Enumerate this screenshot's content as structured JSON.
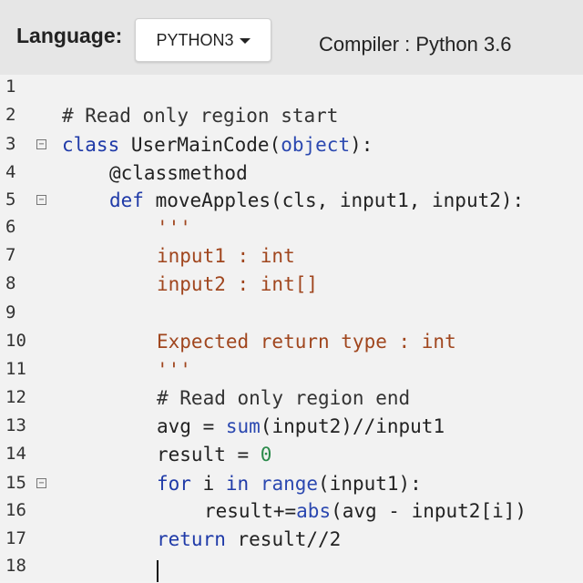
{
  "toolbar": {
    "language_label": "Language:",
    "language_value": "PYTHON3",
    "compiler_text": "Compiler : Python 3.6"
  },
  "editor": {
    "lines": [
      {
        "num": "1",
        "segments": []
      },
      {
        "num": "2",
        "segments": [
          {
            "text": "# Read only region start",
            "type": "comment"
          }
        ]
      },
      {
        "num": "3",
        "fold": true,
        "segments": [
          {
            "text": "class ",
            "type": "kw"
          },
          {
            "text": "UserMainCode(",
            "type": "plain"
          },
          {
            "text": "object",
            "type": "builtin"
          },
          {
            "text": "):",
            "type": "plain"
          }
        ]
      },
      {
        "num": "4",
        "segments": [
          {
            "text": "@classmethod",
            "type": "plain"
          }
        ]
      },
      {
        "num": "5",
        "fold": true,
        "segments": [
          {
            "text": "def ",
            "type": "kw"
          },
          {
            "text": "moveApples(cls, input1, input2):",
            "type": "plain"
          }
        ]
      },
      {
        "num": "6",
        "segments": [
          {
            "text": "'''",
            "type": "doc"
          }
        ]
      },
      {
        "num": "7",
        "segments": [
          {
            "text": "input1 : int",
            "type": "doc"
          }
        ]
      },
      {
        "num": "8",
        "segments": [
          {
            "text": "input2 : int[]",
            "type": "doc"
          }
        ]
      },
      {
        "num": "9",
        "segments": []
      },
      {
        "num": "10",
        "segments": [
          {
            "text": "Expected return type : int",
            "type": "doc"
          }
        ]
      },
      {
        "num": "11",
        "segments": [
          {
            "text": "'''",
            "type": "doc"
          }
        ]
      },
      {
        "num": "12",
        "segments": [
          {
            "text": "# Read only region end",
            "type": "comment"
          }
        ]
      },
      {
        "num": "13",
        "segments": [
          {
            "text": "avg = ",
            "type": "plain"
          },
          {
            "text": "sum",
            "type": "builtin"
          },
          {
            "text": "(input2)//input1",
            "type": "plain"
          }
        ]
      },
      {
        "num": "14",
        "segments": [
          {
            "text": "result = ",
            "type": "plain"
          },
          {
            "text": "0",
            "type": "num"
          }
        ]
      },
      {
        "num": "15",
        "fold": true,
        "segments": [
          {
            "text": "for ",
            "type": "kw"
          },
          {
            "text": "i ",
            "type": "plain"
          },
          {
            "text": "in ",
            "type": "kw"
          },
          {
            "text": "range",
            "type": "builtin"
          },
          {
            "text": "(input1):",
            "type": "plain"
          }
        ]
      },
      {
        "num": "16",
        "segments": [
          {
            "text": "result+=",
            "type": "plain"
          },
          {
            "text": "abs",
            "type": "builtin"
          },
          {
            "text": "(avg - input2[i])",
            "type": "plain"
          }
        ]
      },
      {
        "num": "17",
        "segments": [
          {
            "text": "return ",
            "type": "kw"
          },
          {
            "text": "result//2",
            "type": "plain"
          }
        ]
      },
      {
        "num": "18",
        "segments": []
      }
    ]
  }
}
